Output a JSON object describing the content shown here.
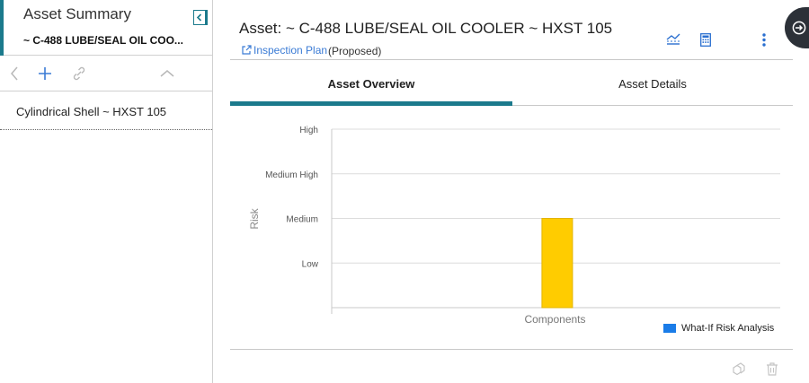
{
  "left_panel": {
    "title": "Asset Summary",
    "subtitle": "~ C-488 LUBE/SEAL OIL COO...",
    "tree_items": [
      {
        "label": "Cylindrical Shell ~ HXST 105"
      }
    ]
  },
  "main": {
    "title": "Asset: ~ C-488 LUBE/SEAL OIL COOLER ~ HXST 105",
    "plan_link": "Inspection Plan",
    "plan_status": "(Proposed)",
    "tabs": [
      {
        "label": "Asset Overview",
        "active": true
      },
      {
        "label": "Asset Details",
        "active": false
      }
    ]
  },
  "colors": {
    "accent": "#1b7a8c",
    "link": "#3a7bd5",
    "bar": "#ffcc00",
    "legend": "#1a7ce8"
  },
  "chart_data": {
    "type": "bar",
    "xlabel": "Components",
    "ylabel": "Risk",
    "y_categories": [
      "Low",
      "Medium",
      "Medium High",
      "High"
    ],
    "ylim": [
      0,
      4
    ],
    "categories": [
      ""
    ],
    "series": [
      {
        "name": "What-If Risk Analysis",
        "values": [
          2
        ]
      }
    ],
    "grid": true,
    "legend_position": "bottom-right"
  }
}
